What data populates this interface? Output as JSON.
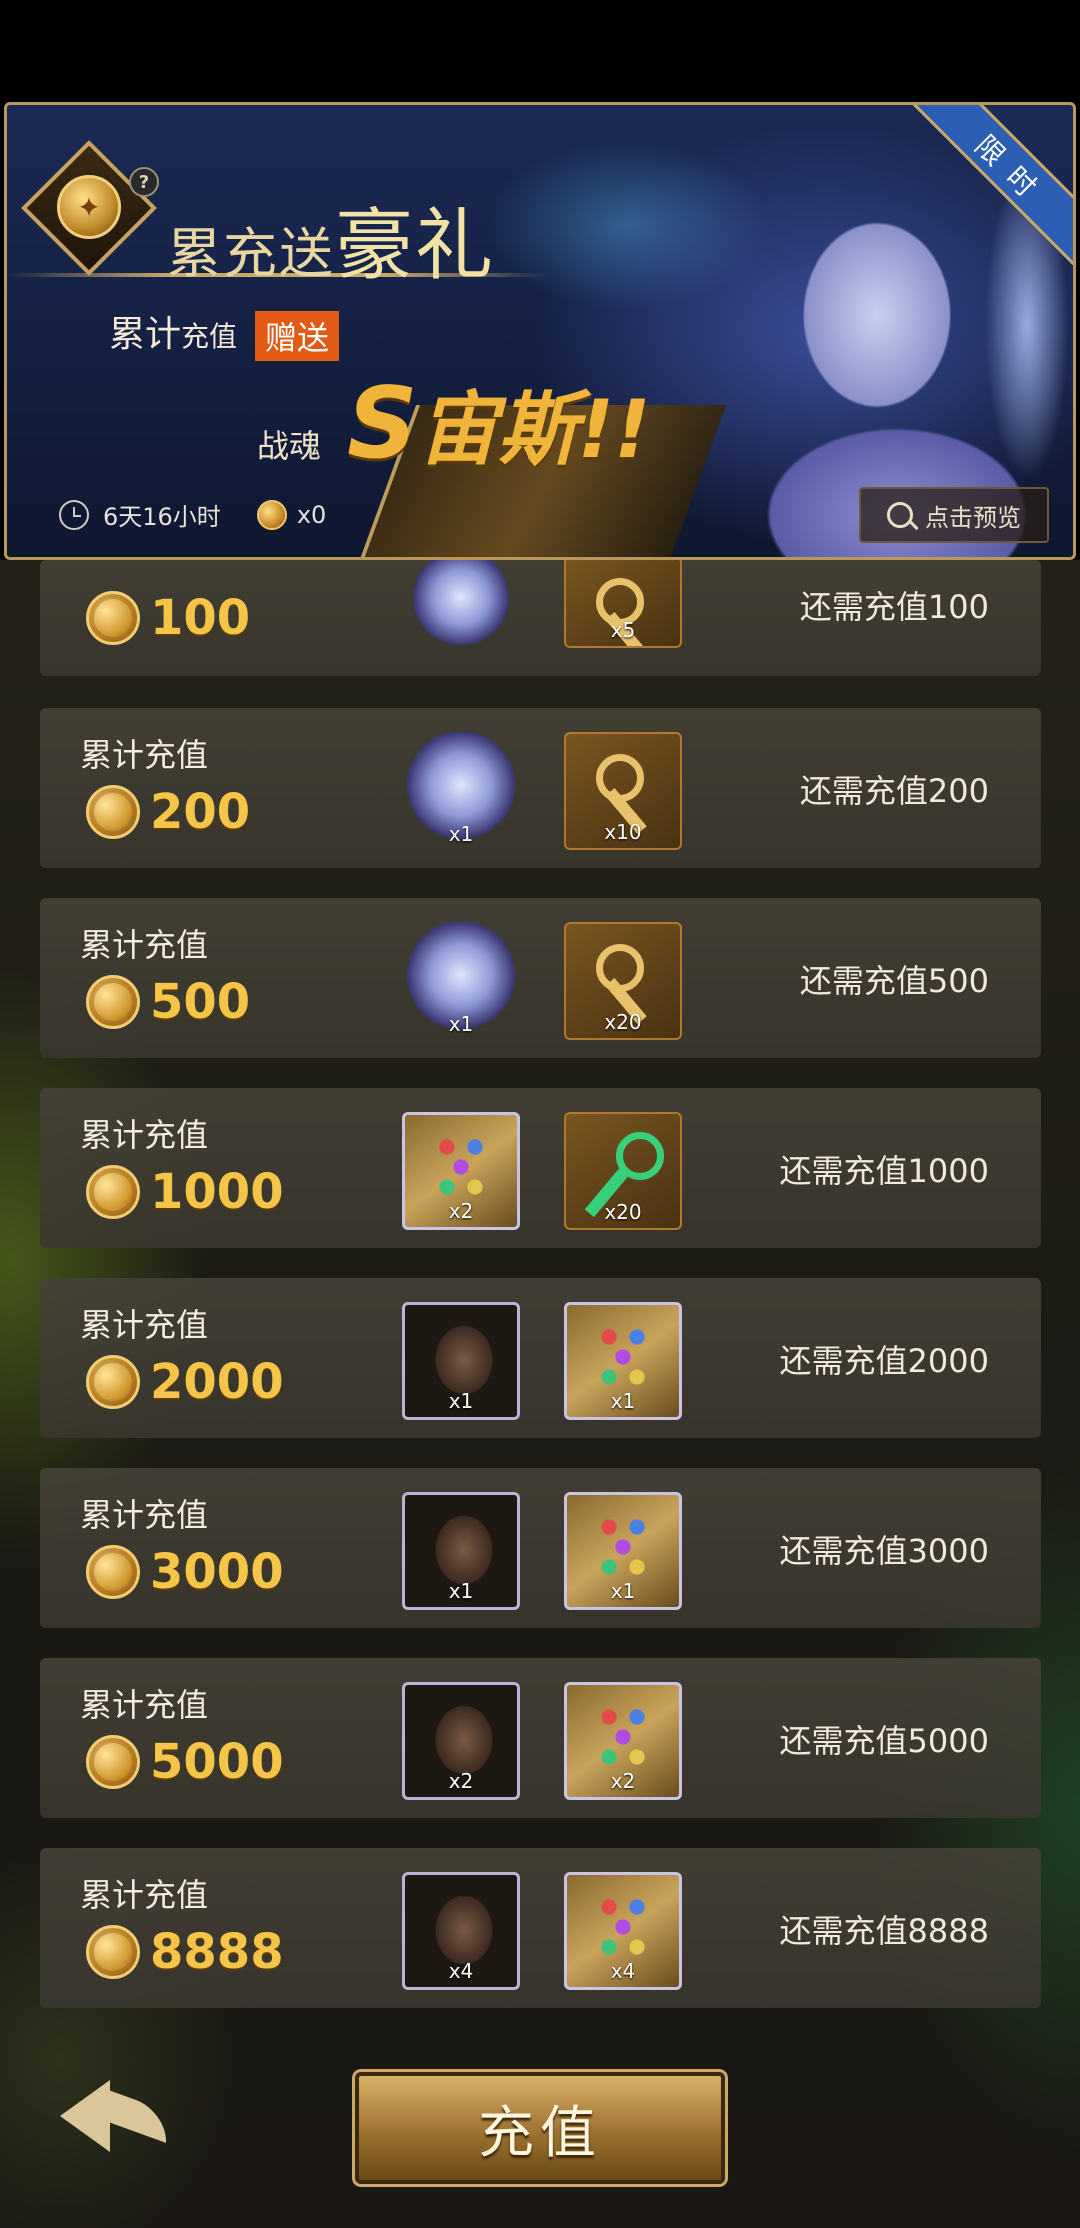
{
  "banner": {
    "title_small": "累充送",
    "title_big": "豪礼",
    "help": "?",
    "sub_big": "累计",
    "sub_small": "充值",
    "gift_tag": "赠送",
    "hero_label": "战魂",
    "hero_rank": "S",
    "hero_name": "宙斯",
    "hero_suffix": "!!",
    "timer": "6天16小时",
    "coin_count": "x0",
    "preview": "点击预览",
    "ribbon": "限时"
  },
  "tiers": [
    {
      "label": "",
      "amount": "100",
      "need": "还需充值100",
      "items": [
        {
          "type": "soul",
          "qty": ""
        },
        {
          "type": "key-gold",
          "qty": "x5"
        }
      ]
    },
    {
      "label": "累计充值",
      "amount": "200",
      "need": "还需充值200",
      "items": [
        {
          "type": "soul",
          "qty": "x1"
        },
        {
          "type": "key-gold",
          "qty": "x10"
        }
      ]
    },
    {
      "label": "累计充值",
      "amount": "500",
      "need": "还需充值500",
      "items": [
        {
          "type": "soul",
          "qty": "x1"
        },
        {
          "type": "key-gold",
          "qty": "x20"
        }
      ]
    },
    {
      "label": "累计充值",
      "amount": "1000",
      "need": "还需充值1000",
      "items": [
        {
          "type": "card",
          "qty": "x2"
        },
        {
          "type": "key-green",
          "qty": "x20"
        }
      ]
    },
    {
      "label": "累计充值",
      "amount": "2000",
      "need": "还需充值2000",
      "items": [
        {
          "type": "helmet",
          "qty": "x1"
        },
        {
          "type": "card",
          "qty": "x1"
        }
      ]
    },
    {
      "label": "累计充值",
      "amount": "3000",
      "need": "还需充值3000",
      "items": [
        {
          "type": "helmet",
          "qty": "x1"
        },
        {
          "type": "card",
          "qty": "x1"
        }
      ]
    },
    {
      "label": "累计充值",
      "amount": "5000",
      "need": "还需充值5000",
      "items": [
        {
          "type": "helmet",
          "qty": "x2"
        },
        {
          "type": "card",
          "qty": "x2"
        }
      ]
    },
    {
      "label": "累计充值",
      "amount": "8888",
      "need": "还需充值8888",
      "items": [
        {
          "type": "helmet",
          "qty": "x4"
        },
        {
          "type": "card",
          "qty": "x4"
        }
      ]
    }
  ],
  "bottom": {
    "recharge_label": "充值"
  }
}
